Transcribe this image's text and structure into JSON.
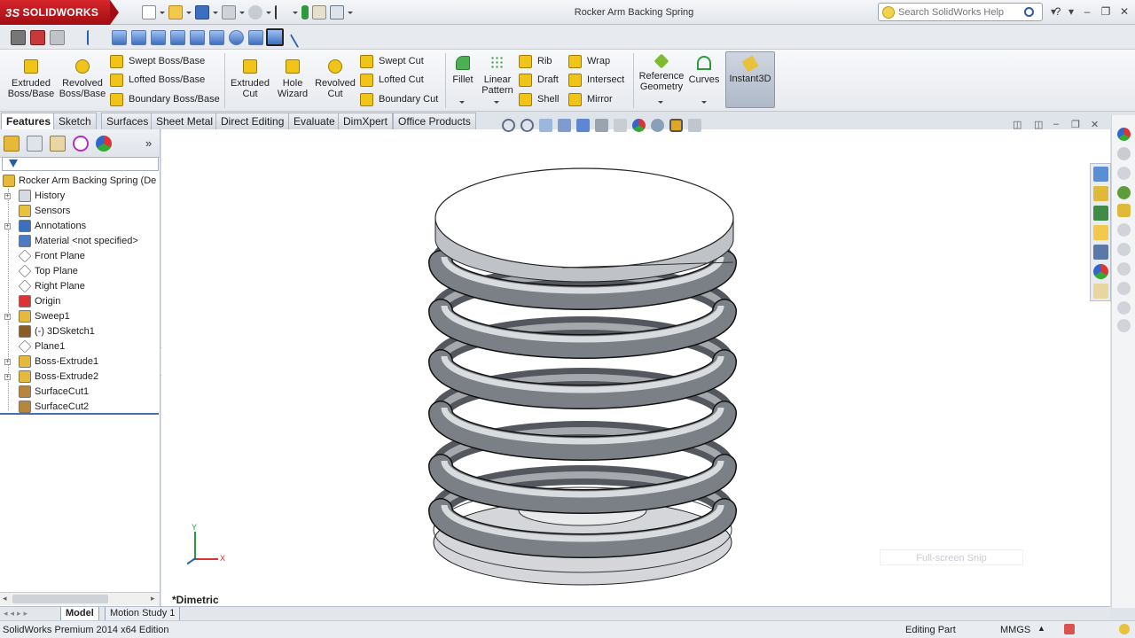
{
  "app": {
    "brand": "SOLIDWORKS",
    "brand_prefix": "3S",
    "document_title": "Rocker Arm Backing Spring"
  },
  "search": {
    "placeholder": "Search SolidWorks Help"
  },
  "command_manager": {
    "extruded_boss": "Extruded Boss/Base",
    "revolved_boss": "Revolved Boss/Base",
    "swept_boss": "Swept Boss/Base",
    "lofted_boss": "Lofted Boss/Base",
    "boundary_boss": "Boundary Boss/Base",
    "extruded_cut": "Extruded Cut",
    "hole_wizard": "Hole Wizard",
    "revolved_cut": "Revolved Cut",
    "swept_cut": "Swept Cut",
    "lofted_cut": "Lofted Cut",
    "boundary_cut": "Boundary Cut",
    "fillet": "Fillet",
    "linear_pattern": "Linear Pattern",
    "rib": "Rib",
    "draft": "Draft",
    "shell": "Shell",
    "wrap": "Wrap",
    "intersect": "Intersect",
    "mirror": "Mirror",
    "reference_geometry": "Reference Geometry",
    "curves": "Curves",
    "instant3d": "Instant3D"
  },
  "tabs": [
    "Features",
    "Sketch",
    "Surfaces",
    "Sheet Metal",
    "Direct Editing",
    "Evaluate",
    "DimXpert",
    "Office Products"
  ],
  "tree": {
    "root": "Rocker Arm Backing Spring  (De",
    "items": [
      {
        "label": "History",
        "icon": "history-icon",
        "expandable": true
      },
      {
        "label": "Sensors",
        "icon": "sensors-icon",
        "expandable": false
      },
      {
        "label": "Annotations",
        "icon": "annotations-icon",
        "expandable": true
      },
      {
        "label": "Material <not specified>",
        "icon": "material-icon",
        "expandable": false
      },
      {
        "label": "Front Plane",
        "icon": "plane-icon",
        "expandable": false
      },
      {
        "label": "Top Plane",
        "icon": "plane-icon",
        "expandable": false
      },
      {
        "label": "Right Plane",
        "icon": "plane-icon",
        "expandable": false
      },
      {
        "label": "Origin",
        "icon": "origin-icon",
        "expandable": false
      },
      {
        "label": "Sweep1",
        "icon": "sweep-icon",
        "expandable": true
      },
      {
        "label": "(-) 3DSketch1",
        "icon": "sketch-icon",
        "expandable": false
      },
      {
        "label": "Plane1",
        "icon": "plane-icon",
        "expandable": false
      },
      {
        "label": "Boss-Extrude1",
        "icon": "extrude-icon",
        "expandable": true
      },
      {
        "label": "Boss-Extrude2",
        "icon": "extrude-icon",
        "expandable": true
      },
      {
        "label": "SurfaceCut1",
        "icon": "surfacecut-icon",
        "expandable": false
      },
      {
        "label": "SurfaceCut2",
        "icon": "surfacecut-icon",
        "expandable": false
      }
    ]
  },
  "viewport": {
    "view_label": "*Dimetric",
    "snip_text": "Full-screen Snip",
    "triad": {
      "x": "X",
      "y": "Y"
    }
  },
  "bottom_tabs": [
    "Model",
    "Motion Study 1"
  ],
  "status": {
    "edition": "SolidWorks Premium 2014 x64 Edition",
    "mode": "Editing Part",
    "units": "MMGS"
  },
  "colors": {
    "brand_red": "#c8161d",
    "tree_divider": "#4a6fa8",
    "spring": "#8d9196"
  }
}
